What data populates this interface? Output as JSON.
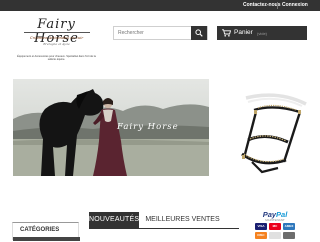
{
  "topbar": {
    "contact_label": "Contactez-nous",
    "login_label": "Connexion"
  },
  "logo": {
    "name": "Fairy Horse",
    "tagline": "Créations Artisanales en cuir",
    "location": "Bretagne et Ajoie",
    "description": "Équipement et Accessoires pour chevaux. Spécialisé dans l'Art de la sellerie équine."
  },
  "search": {
    "placeholder": "Rechercher",
    "icon": "search-icon"
  },
  "cart": {
    "label": "Panier",
    "status": "(vide)",
    "icon": "cart-icon"
  },
  "slider": {
    "caption": "Fairy Horse"
  },
  "tabs": [
    {
      "label": "NOUVEAUTÉS",
      "active": true
    },
    {
      "label": "MEILLEURES VENTES",
      "active": false
    }
  ],
  "categories": {
    "label": "CATÉGORIES"
  },
  "payment": {
    "brand_a": "Pay",
    "brand_b": "Pal",
    "subtitle": "MAINTENANT",
    "cards": [
      "VISA",
      "MC",
      "AMEX",
      "DISC"
    ]
  },
  "colors": {
    "dark": "#333333",
    "accent_brown": "#7a3b14",
    "paypal_blue": "#253b80",
    "paypal_light": "#179bd7"
  }
}
